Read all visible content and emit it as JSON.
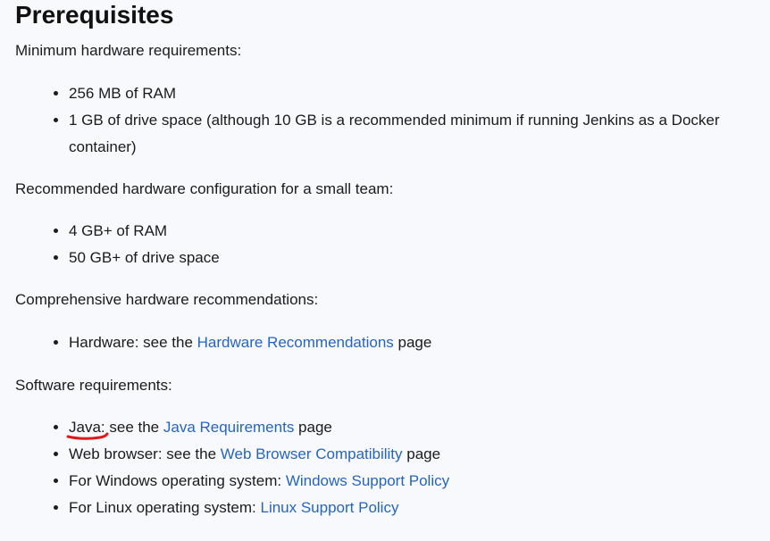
{
  "heading": "Prerequisites",
  "min_hw": {
    "intro": "Minimum hardware requirements:",
    "items": [
      "256 MB of RAM",
      "1 GB of drive space (although 10 GB is a recommended minimum if running Jenkins as a Docker container)"
    ]
  },
  "rec_hw": {
    "intro": "Recommended hardware configuration for a small team:",
    "items": [
      "4 GB+ of RAM",
      "50 GB+ of drive space"
    ]
  },
  "comp_hw": {
    "intro": "Comprehensive hardware recommendations:",
    "hardware": {
      "prefix": "Hardware: see the ",
      "link": "Hardware Recommendations",
      "suffix": " page"
    }
  },
  "software": {
    "intro": "Software requirements:",
    "java": {
      "label": "Java",
      "prefix": ": see the ",
      "link": "Java Requirements",
      "suffix": " page"
    },
    "browser": {
      "prefix": "Web browser: see the ",
      "link": "Web Browser Compatibility",
      "suffix": " page"
    },
    "windows": {
      "prefix": "For Windows operating system: ",
      "link": "Windows Support Policy"
    },
    "linux": {
      "prefix": "For Linux operating system: ",
      "link": "Linux Support Policy"
    }
  },
  "colors": {
    "link": "#2565c1",
    "annotation": "#e0191c",
    "background": "#f8f9fd"
  }
}
